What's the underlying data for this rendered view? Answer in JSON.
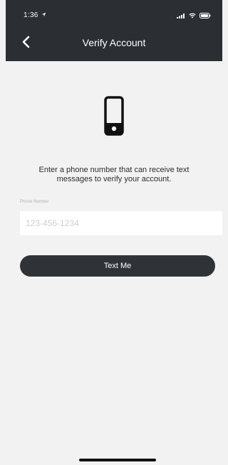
{
  "status_bar": {
    "time": "1:36",
    "location_icon": "location-arrow-icon",
    "signal_icon": "signal-bars-icon",
    "wifi_icon": "wifi-icon",
    "battery_icon": "battery-icon"
  },
  "nav": {
    "back_icon": "chevron-left-icon",
    "title": "Verify Account"
  },
  "content": {
    "phone_icon": "smartphone-icon",
    "prompt": "Enter a phone number that can receive text messages to verify your account.",
    "phone_label": "Phone Number",
    "phone_placeholder": "123-456-1234",
    "phone_value": ""
  },
  "actions": {
    "text_me_label": "Text Me"
  },
  "colors": {
    "header_bg": "#2b2e32",
    "page_bg": "#f2f2f2",
    "button_bg": "#2f3338"
  }
}
